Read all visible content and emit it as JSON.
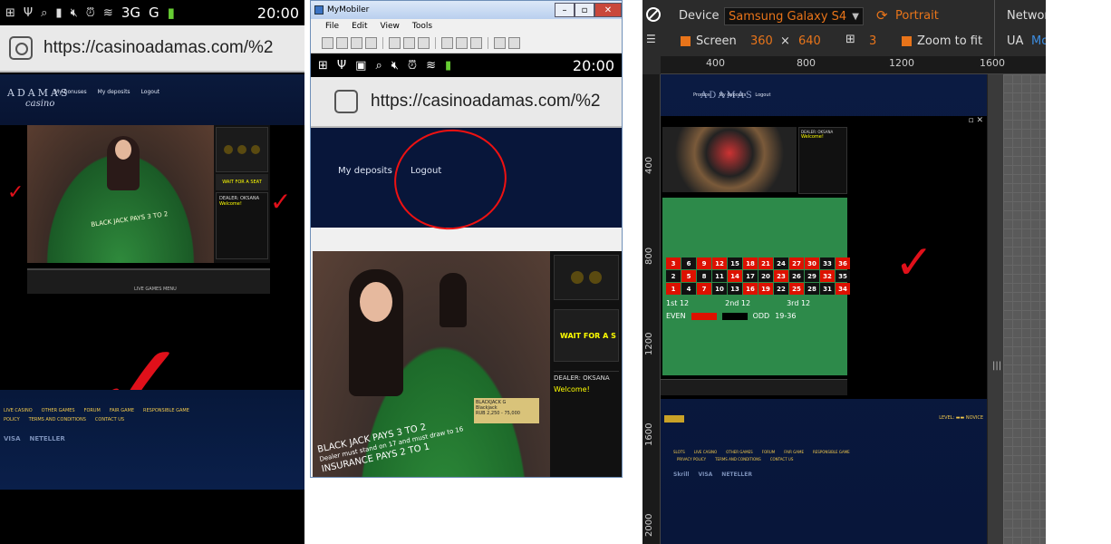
{
  "phone": {
    "clock": "20:00",
    "signal1": "3G",
    "signal2": "G",
    "url": "https://casinoadamas.com/%2",
    "logo_top": "ADAMAS",
    "logo_bottom": "casino",
    "nav": [
      "My bonuses",
      "My deposits",
      "Logout"
    ],
    "wait_label": "WAIT FOR A SEAT",
    "dealer_label": "DEALER: OKSANA",
    "welcome": "Welcome!",
    "table_text": "BLACK JACK PAYS 3 TO 2",
    "games_menu": "LIVE GAMES MENU",
    "footer_row1": [
      "LIVE CASINO",
      "OTHER GAMES",
      "FORUM",
      "FAIR GAME",
      "RESPONSIBLE GAME"
    ],
    "footer_row2": [
      "POLICY",
      "TERMS AND CONDITIONS",
      "CONTACT US"
    ],
    "payments": [
      "VISA",
      "NETELLER"
    ]
  },
  "mobiler": {
    "title": "MyMobiler",
    "menu": [
      "File",
      "Edit",
      "View",
      "Tools"
    ],
    "clock": "20:00",
    "url": "https://casinoadamas.com/%2",
    "nav_deposits": "My deposits",
    "nav_logout": "Logout",
    "wait_label": "WAIT FOR A S",
    "dealer_label": "DEALER: OKSANA",
    "welcome": "Welcome!",
    "table_text": "BLACK JACK PAYS 3 TO 2",
    "table_text2": "Dealer must stand on 17 and must draw to 16",
    "table_text3": "INSURANCE PAYS 2 TO 1",
    "sign_title": "BLACKJACK G",
    "sign_sub": "Blackjack",
    "sign_limits": "RUB 2,250 - 75,000"
  },
  "emulator": {
    "device_label": "Device",
    "device_value": "Samsung Galaxy S4",
    "orientation": "Portrait",
    "network": "Networ",
    "screen_label": "Screen",
    "width": "360",
    "times": "×",
    "height": "640",
    "scale": "3",
    "zoom_label": "Zoom to fit",
    "ua_label": "UA",
    "ua_value": "Mo",
    "ruler_top": [
      "400",
      "800",
      "1200",
      "1600"
    ],
    "ruler_left": [
      "400",
      "800",
      "1200",
      "1600",
      "2000"
    ],
    "logo": "ADAMAS",
    "nav": [
      "Promos",
      "My deposits",
      "Logout"
    ],
    "dealer_label": "DEALER: OKSANA",
    "welcome": "Welcome!",
    "row1": [
      "3",
      "6",
      "9",
      "12",
      "15",
      "18",
      "21",
      "24",
      "27",
      "30",
      "33",
      "36"
    ],
    "row2": [
      "2",
      "5",
      "8",
      "11",
      "14",
      "17",
      "20",
      "23",
      "26",
      "29",
      "32",
      "35"
    ],
    "row3": [
      "1",
      "4",
      "7",
      "10",
      "13",
      "16",
      "19",
      "22",
      "25",
      "28",
      "31",
      "34"
    ],
    "dozens": [
      "1st 12",
      "2nd 12",
      "3rd 12"
    ],
    "outside": [
      "EVEN",
      "ODD",
      "19-36"
    ],
    "level": "LEVEL:",
    "novice": "NOVICE",
    "footer_row1": [
      "SLOTS",
      "LIVE CASINO",
      "OTHER GAMES",
      "FORUM",
      "FAIR GAME",
      "RESPONSIBLE GAME"
    ],
    "footer_row2": [
      "PRIVACY POLICY",
      "TERMS AND CONDITIONS",
      "CONTACT US"
    ],
    "payments": [
      "Skrill",
      "VISA",
      "NETELLER"
    ]
  },
  "colors": {
    "check_mark": "#e0101a",
    "accent_orange": "#e8741a",
    "site_blue": "#08163a",
    "link_gold": "#f2c94c"
  }
}
